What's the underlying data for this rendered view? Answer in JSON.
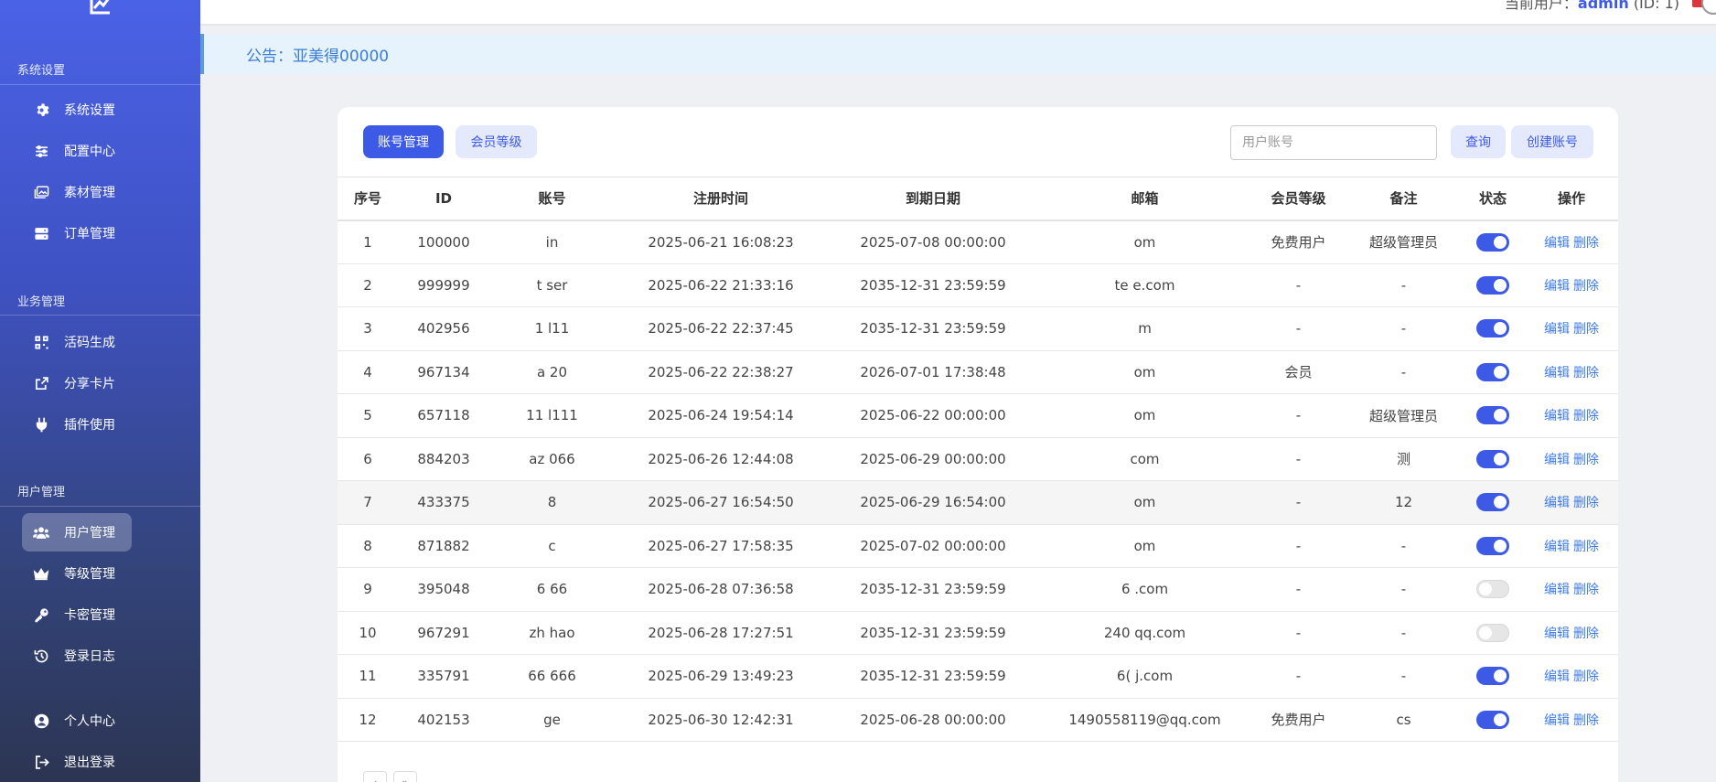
{
  "sidebar": {
    "sections": [
      {
        "title": "系统设置",
        "items": [
          {
            "label": "系统设置",
            "icon": "gear-icon"
          },
          {
            "label": "配置中心",
            "icon": "sliders-icon"
          },
          {
            "label": "素材管理",
            "icon": "images-icon"
          },
          {
            "label": "订单管理",
            "icon": "server-icon"
          }
        ]
      },
      {
        "title": "业务管理",
        "items": [
          {
            "label": "活码生成",
            "icon": "qrcode-icon"
          },
          {
            "label": "分享卡片",
            "icon": "share-icon"
          },
          {
            "label": "插件使用",
            "icon": "plug-icon"
          }
        ]
      },
      {
        "title": "用户管理",
        "items": [
          {
            "label": "用户管理",
            "icon": "users-icon",
            "active": true
          },
          {
            "label": "等级管理",
            "icon": "crown-icon"
          },
          {
            "label": "卡密管理",
            "icon": "key-icon"
          },
          {
            "label": "登录日志",
            "icon": "history-icon"
          }
        ]
      }
    ],
    "bottom": [
      {
        "label": "个人中心",
        "icon": "user-circle-icon"
      },
      {
        "label": "退出登录",
        "icon": "logout-icon"
      }
    ]
  },
  "topbar": {
    "user_prefix": "当前用户：",
    "user_name": "admin",
    "user_id": "(ID: 1)"
  },
  "notice": "公告：亚美得00000",
  "tabs": [
    "账号管理",
    "会员等级"
  ],
  "search": {
    "placeholder": "用户账号",
    "query_label": "查询",
    "create_label": "创建账号"
  },
  "table": {
    "headers": [
      "序号",
      "ID",
      "账号",
      "注册时间",
      "到期日期",
      "邮箱",
      "会员等级",
      "备注",
      "状态",
      "操作"
    ],
    "rows": [
      {
        "no": "1",
        "id": "100000",
        "account": "in",
        "reg": "2025-06-21 16:08:23",
        "exp": "2025-07-08 00:00:00",
        "email": "om",
        "level": "免费用户",
        "note": "超级管理员",
        "on": true
      },
      {
        "no": "2",
        "id": "999999",
        "account": "t ser",
        "reg": "2025-06-22 21:33:16",
        "exp": "2035-12-31 23:59:59",
        "email": "te e.com",
        "level": "-",
        "note": "-",
        "on": true
      },
      {
        "no": "3",
        "id": "402956",
        "account": "1 l11",
        "reg": "2025-06-22 22:37:45",
        "exp": "2035-12-31 23:59:59",
        "email": "m",
        "level": "-",
        "note": "-",
        "on": true
      },
      {
        "no": "4",
        "id": "967134",
        "account": "a 20",
        "reg": "2025-06-22 22:38:27",
        "exp": "2026-07-01 17:38:48",
        "email": "om",
        "level": "会员",
        "note": "-",
        "on": true
      },
      {
        "no": "5",
        "id": "657118",
        "account": "11 l111",
        "reg": "2025-06-24 19:54:14",
        "exp": "2025-06-22 00:00:00",
        "email": "om",
        "level": "-",
        "note": "超级管理员",
        "on": true
      },
      {
        "no": "6",
        "id": "884203",
        "account": "az 066",
        "reg": "2025-06-26 12:44:08",
        "exp": "2025-06-29 00:00:00",
        "email": "com",
        "level": "-",
        "note": "测",
        "on": true
      },
      {
        "no": "7",
        "id": "433375",
        "account": "8",
        "reg": "2025-06-27 16:54:50",
        "exp": "2025-06-29 16:54:00",
        "email": "om",
        "level": "-",
        "note": "12",
        "on": true
      },
      {
        "no": "8",
        "id": "871882",
        "account": "c",
        "reg": "2025-06-27 17:58:35",
        "exp": "2025-07-02 00:00:00",
        "email": "om",
        "level": "-",
        "note": "-",
        "on": true
      },
      {
        "no": "9",
        "id": "395048",
        "account": "6 66",
        "reg": "2025-06-28 07:36:58",
        "exp": "2035-12-31 23:59:59",
        "email": "6 .com",
        "level": "-",
        "note": "-",
        "on": false
      },
      {
        "no": "10",
        "id": "967291",
        "account": "zh hao",
        "reg": "2025-06-28 17:27:51",
        "exp": "2035-12-31 23:59:59",
        "email": "240 qq.com",
        "level": "-",
        "note": "-",
        "on": false
      },
      {
        "no": "11",
        "id": "335791",
        "account": "66 666",
        "reg": "2025-06-29 13:49:23",
        "exp": "2035-12-31 23:59:59",
        "email": "6( j.com",
        "level": "-",
        "note": "-",
        "on": true
      },
      {
        "no": "12",
        "id": "402153",
        "account": "ge",
        "reg": "2025-06-30 12:42:31",
        "exp": "2025-06-28 00:00:00",
        "email": "1490558119@qq.com",
        "level": "免费用户",
        "note": "cs",
        "on": true
      }
    ],
    "edit_label": "编辑",
    "delete_label": "删除"
  },
  "pagination": [
    "‹",
    "»"
  ],
  "colors": {
    "primary": "#3d5ae6",
    "link": "#3d7bea",
    "notice_text": "#3b7dd8"
  }
}
